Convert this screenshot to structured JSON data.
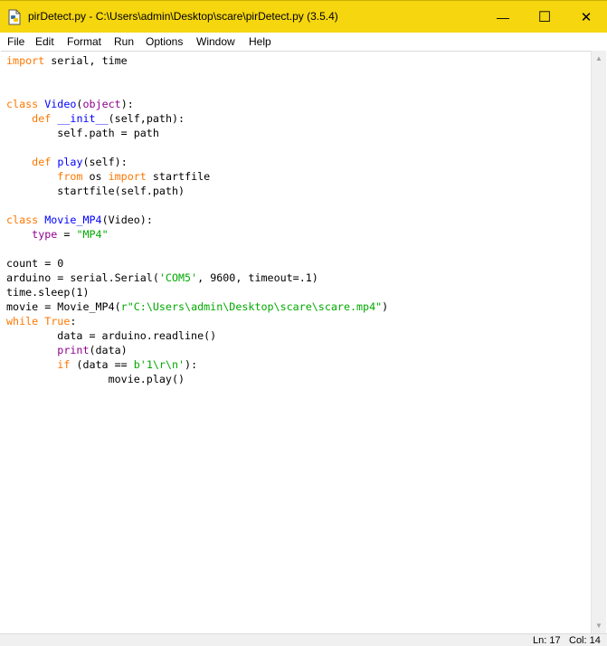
{
  "window": {
    "title": "pirDetect.py - C:\\Users\\admin\\Desktop\\scare\\pirDetect.py (3.5.4)",
    "controls": {
      "minimize": "—",
      "maximize": "☐",
      "close": "✕"
    },
    "accent_color": "#f5d60f"
  },
  "menu": {
    "file": "File",
    "edit": "Edit",
    "format": "Format",
    "run": "Run",
    "options": "Options",
    "window": "Window",
    "help": "Help"
  },
  "editor": {
    "lines": [
      [
        {
          "t": "import",
          "c": "kw"
        },
        {
          "t": " serial, time"
        }
      ],
      [],
      [],
      [
        {
          "t": "class",
          "c": "kw"
        },
        {
          "t": " "
        },
        {
          "t": "Video",
          "c": "df"
        },
        {
          "t": "("
        },
        {
          "t": "object",
          "c": "bi"
        },
        {
          "t": "):"
        }
      ],
      [
        {
          "t": "    "
        },
        {
          "t": "def",
          "c": "kw"
        },
        {
          "t": " "
        },
        {
          "t": "__init__",
          "c": "df"
        },
        {
          "t": "(self,path):"
        }
      ],
      [
        {
          "t": "        self.path = path"
        }
      ],
      [],
      [
        {
          "t": "    "
        },
        {
          "t": "def",
          "c": "kw"
        },
        {
          "t": " "
        },
        {
          "t": "play",
          "c": "df"
        },
        {
          "t": "(self):"
        }
      ],
      [
        {
          "t": "        "
        },
        {
          "t": "from",
          "c": "kw"
        },
        {
          "t": " os "
        },
        {
          "t": "import",
          "c": "kw"
        },
        {
          "t": " startfile"
        }
      ],
      [
        {
          "t": "        startfile(self.path)"
        }
      ],
      [],
      [
        {
          "t": "class",
          "c": "kw"
        },
        {
          "t": " "
        },
        {
          "t": "Movie_MP4",
          "c": "df"
        },
        {
          "t": "(Video):"
        }
      ],
      [
        {
          "t": "    "
        },
        {
          "t": "type",
          "c": "bi"
        },
        {
          "t": " = "
        },
        {
          "t": "\"MP4\"",
          "c": "st"
        }
      ],
      [],
      [
        {
          "t": "count = 0"
        }
      ],
      [
        {
          "t": "arduino = serial.Serial("
        },
        {
          "t": "'COM5'",
          "c": "st"
        },
        {
          "t": ", 9600, timeout=.1)"
        }
      ],
      [
        {
          "t": "time.sleep(1)"
        }
      ],
      [
        {
          "t": "movie = Movie_MP4("
        },
        {
          "t": "r\"C:\\Users\\admin\\Desktop\\scare\\scare.mp4\"",
          "c": "st"
        },
        {
          "t": ")"
        }
      ],
      [
        {
          "t": "while",
          "c": "kw"
        },
        {
          "t": " "
        },
        {
          "t": "True",
          "c": "kw"
        },
        {
          "t": ":"
        }
      ],
      [
        {
          "t": "        data = arduino.readline()"
        }
      ],
      [
        {
          "t": "        "
        },
        {
          "t": "print",
          "c": "bi"
        },
        {
          "t": "(data)"
        }
      ],
      [
        {
          "t": "        "
        },
        {
          "t": "if",
          "c": "kw"
        },
        {
          "t": " (data == "
        },
        {
          "t": "b'1\\r\\n'",
          "c": "st"
        },
        {
          "t": "):"
        }
      ],
      [
        {
          "t": "                movie.play()"
        }
      ]
    ]
  },
  "scrollbar": {
    "up_arrow": "▲",
    "down_arrow": "▼"
  },
  "status": {
    "line": "Ln: 17",
    "col": "Col: 14"
  }
}
